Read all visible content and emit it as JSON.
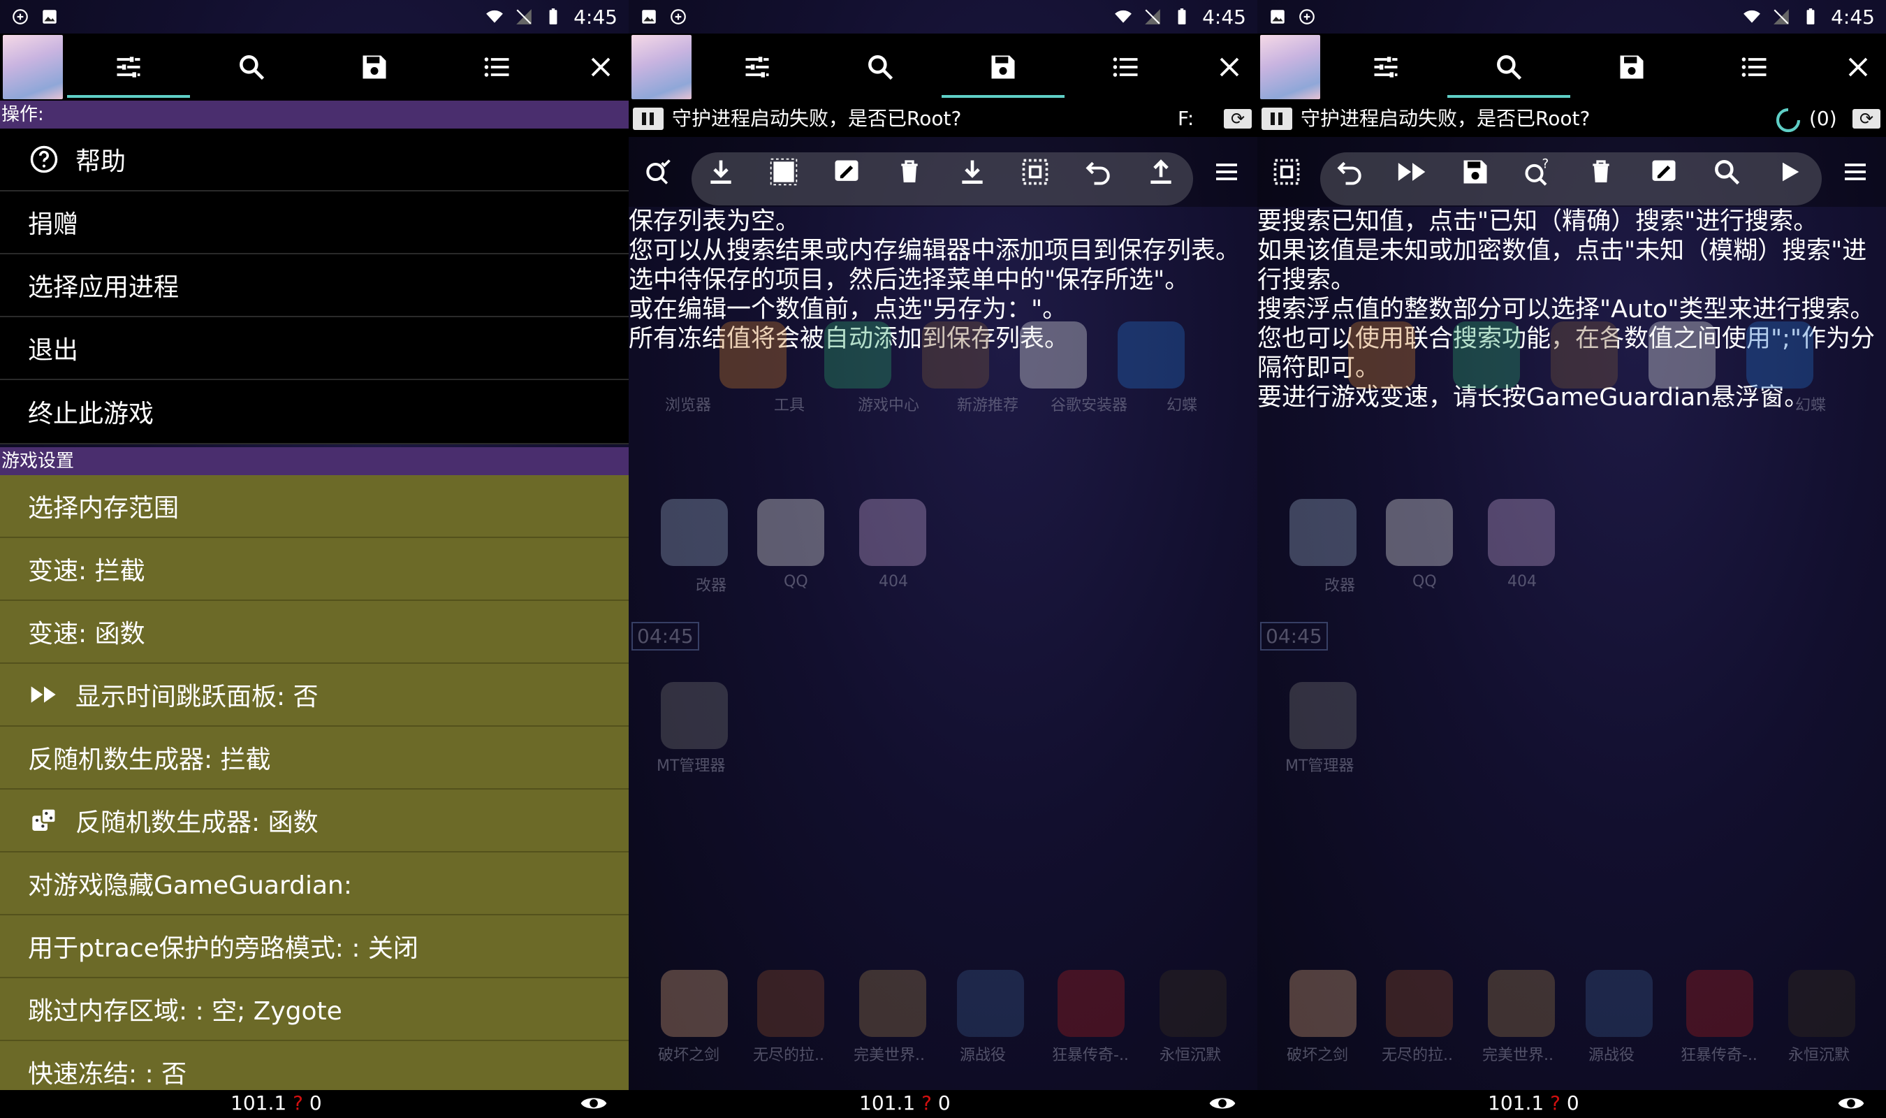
{
  "status_bar": {
    "time": "4:45"
  },
  "menu_panel": {
    "section_actions": "操作:",
    "actions": [
      "帮助",
      "捐赠",
      "选择应用进程",
      "退出",
      "终止此游戏"
    ],
    "section_game_settings": "游戏设置",
    "settings": [
      "选择内存范围",
      "变速: 拦截",
      "变速: 函数",
      "显示时间跳跃面板: 否",
      "反随机数生成器: 拦截",
      "反随机数生成器: 函数",
      "对游戏隐藏GameGuardian:",
      "用于ptrace保护的旁路模式: : 关闭",
      "跳过内存区域: : 空; Zygote",
      "快速冻结: : 否"
    ]
  },
  "bottom_bar": {
    "version": "101.1",
    "question": "?",
    "count": "0"
  },
  "save_panel": {
    "status_message": "守护进程启动失败，是否已Root?",
    "extra_label": "F:",
    "help_lines": [
      "保存列表为空。",
      "您可以从搜索结果或内存编辑器中添加项目到保存列表。",
      "选中待保存的项目，然后选择菜单中的\"保存所选\"。",
      "或在编辑一个数值前，点选\"另存为：\"。",
      "所有冻结值将会被自动添加到保存列表。"
    ]
  },
  "search_panel": {
    "status_message": "守护进程启动失败，是否已Root?",
    "result_count": "(0)",
    "help_lines": [
      "要搜索已知值，点击\"已知（精确）搜索\"进行搜索。",
      "如果该值是未知或加密数值，点击\"未知（模糊）搜索\"进行搜索。",
      "搜索浮点值的整数部分可以选择\"Auto\"类型来进行搜索。",
      "您也可以使用联合搜索功能，在各数值之间使用\";\"作为分隔符即可。",
      "要进行游戏变速，请长按GameGuardian悬浮窗。"
    ]
  },
  "background_apps": {
    "row1": [
      "浏览器",
      "工具",
      "游戏中心",
      "新游推荐",
      "谷歌安装器",
      "幻蝶"
    ],
    "row2": [
      "改器",
      "QQ",
      "404"
    ],
    "clock": "04:45",
    "row3": [
      "MT管理器"
    ],
    "row4": [
      "破坏之剑",
      "无尽的拉..",
      "完美世界..",
      "源战役",
      "狂暴传奇-..",
      "永恒沉默"
    ]
  },
  "colors": {
    "accent": "#5fcfc6",
    "section_header": "#4a2e6e",
    "settings_bg": "#6c6a28",
    "error_mark": "#d01010"
  }
}
